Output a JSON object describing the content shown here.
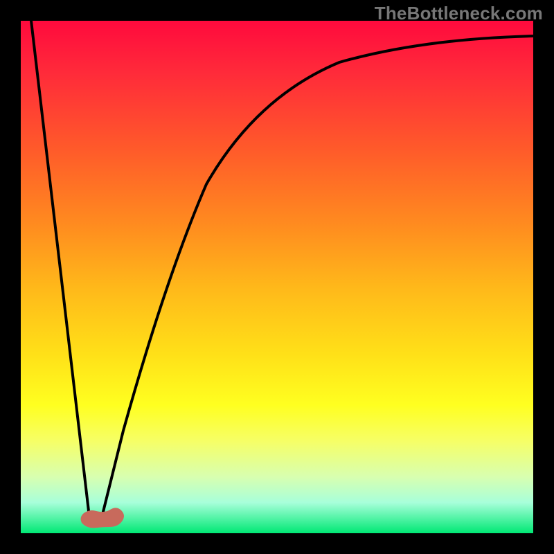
{
  "watermark": "TheBottleneck.com",
  "chart_data": {
    "type": "line",
    "title": "",
    "xlabel": "",
    "ylabel": "",
    "xlim": [
      0,
      100
    ],
    "ylim": [
      0,
      100
    ],
    "series": [
      {
        "name": "curve",
        "x": [
          2,
          13.5,
          15.5,
          20,
          28,
          36,
          46,
          56,
          66,
          76,
          86,
          100
        ],
        "y": [
          100,
          2,
          2,
          20,
          50,
          68,
          80,
          87,
          91,
          94,
          95.5,
          97
        ]
      }
    ],
    "marker": {
      "x": 14.5,
      "y": 2,
      "shape": "blob",
      "color": "#c86a5c"
    },
    "gradient_stops": [
      {
        "pos": 0,
        "color": "#ff0a3d"
      },
      {
        "pos": 25,
        "color": "#ff5a2a"
      },
      {
        "pos": 52,
        "color": "#ffb81a"
      },
      {
        "pos": 75,
        "color": "#ffff20"
      },
      {
        "pos": 100,
        "color": "#00e874"
      }
    ]
  }
}
